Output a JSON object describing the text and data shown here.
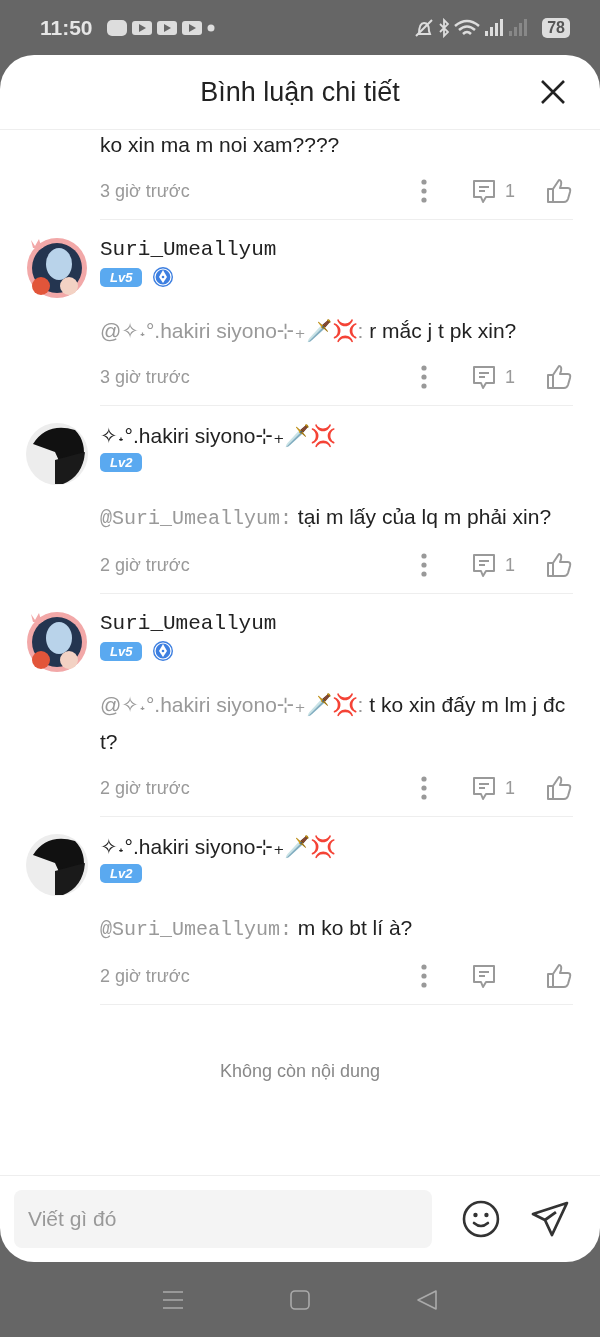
{
  "status_bar": {
    "time": "11:50",
    "battery": "78"
  },
  "header": {
    "title": "Bình luận chi tiết"
  },
  "comments": [
    {
      "kind": "cut",
      "text": "ko xin ma m noi xam????",
      "time": "3 giờ trước",
      "replies": "1"
    },
    {
      "kind": "full",
      "user": "Suri_Umeallyum",
      "mono": true,
      "frame": true,
      "level": "Lv5",
      "badge": true,
      "mention": "@✧˖°.hakiri siyono⊹₊🗡️💢:",
      "text": "r mắc j t pk xin?",
      "time": "3 giờ trước",
      "replies": "1"
    },
    {
      "kind": "full",
      "user": "✧˖°.hakiri siyono⊹₊🗡️💢",
      "mono": false,
      "frame": false,
      "level": "Lv2",
      "badge": false,
      "mention": "@Suri_Umeallyum:",
      "text": "tại m lấy của lq m phải xin?",
      "time": "2 giờ trước",
      "replies": "1"
    },
    {
      "kind": "full",
      "user": "Suri_Umeallyum",
      "mono": true,
      "frame": true,
      "level": "Lv5",
      "badge": true,
      "mention": "@✧˖°.hakiri siyono⊹₊🗡️💢:",
      "text": "t ko xin đấy m lm j đc t?",
      "time": "2 giờ trước",
      "replies": "1"
    },
    {
      "kind": "full",
      "user": "✧˖°.hakiri siyono⊹₊🗡️💢",
      "mono": false,
      "frame": false,
      "level": "Lv2",
      "badge": false,
      "mention": "@Suri_Umeallyum:",
      "text": "m ko bt lí à?",
      "time": "2 giờ trước"
    }
  ],
  "end_note": "Không còn nội dung",
  "composer": {
    "placeholder": "Viết gì đó"
  }
}
